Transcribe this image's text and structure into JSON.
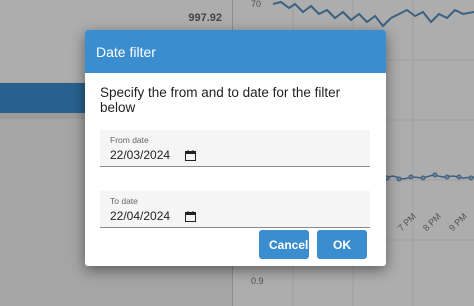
{
  "background": {
    "summary_value": "997.92",
    "chart": {
      "y_tick_top": "70",
      "y_tick_bottom": "0.9",
      "x_ticks": [
        "7 PM",
        "8 PM",
        "9 PM"
      ]
    }
  },
  "dialog": {
    "title": "Date filter",
    "instructions": "Specify the from and to date for the filter below",
    "from_field": {
      "label": "From date",
      "value": "22/03/2024"
    },
    "to_field": {
      "label": "To date",
      "value": "22/04/2024"
    },
    "cancel_label": "Cancel",
    "ok_label": "OK"
  },
  "colors": {
    "accent": "#3a8ed0",
    "chart_line": "#5b8fbf"
  },
  "icons": {
    "calendar": "calendar-icon"
  }
}
